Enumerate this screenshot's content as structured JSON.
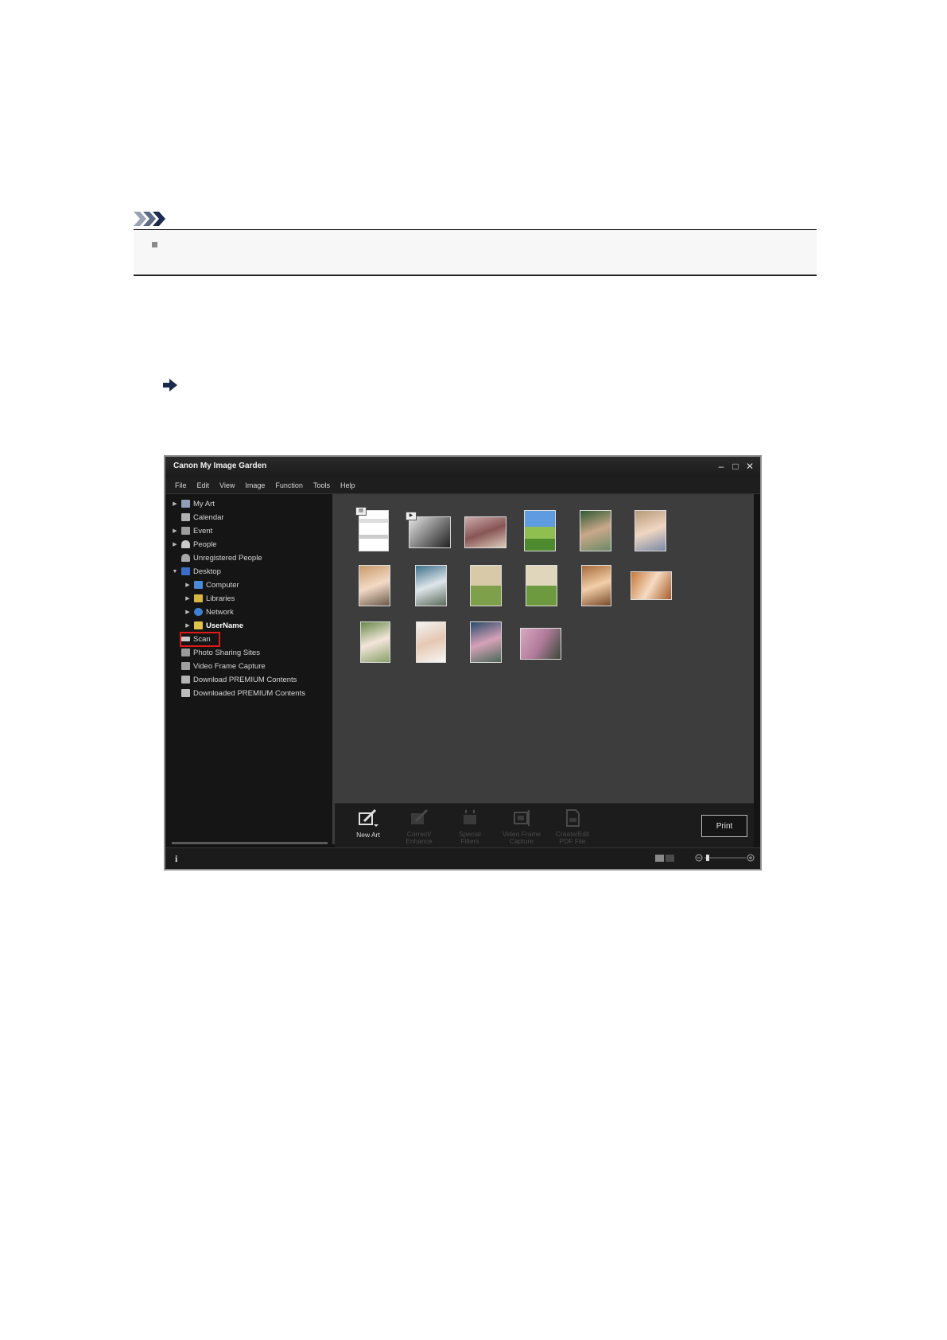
{
  "app": {
    "title": "Canon My Image Garden",
    "menu": [
      "File",
      "Edit",
      "View",
      "Image",
      "Function",
      "Tools",
      "Help"
    ],
    "tree": [
      {
        "label": "My Art",
        "level": 0,
        "arrow": true,
        "icon": "my-art-icon"
      },
      {
        "label": "Calendar",
        "level": 0,
        "arrow": false,
        "icon": "calendar-icon"
      },
      {
        "label": "Event",
        "level": 0,
        "arrow": true,
        "icon": "event-icon"
      },
      {
        "label": "People",
        "level": 0,
        "arrow": true,
        "icon": "people-icon"
      },
      {
        "label": "Unregistered People",
        "level": 0,
        "arrow": false,
        "icon": "unregistered-people-icon"
      },
      {
        "label": "Desktop",
        "level": 0,
        "arrow": true,
        "expanded": true,
        "icon": "desktop-icon"
      },
      {
        "label": "Computer",
        "level": 1,
        "arrow": true,
        "icon": "computer-icon"
      },
      {
        "label": "Libraries",
        "level": 1,
        "arrow": true,
        "icon": "libraries-icon"
      },
      {
        "label": "Network",
        "level": 1,
        "arrow": true,
        "icon": "network-icon"
      },
      {
        "label": "UserName",
        "level": 1,
        "arrow": true,
        "bold": true,
        "icon": "user-folder-icon"
      },
      {
        "label": "Scan",
        "level": 0,
        "arrow": false,
        "highlighted": true,
        "icon": "scan-icon"
      },
      {
        "label": "Photo Sharing Sites",
        "level": 0,
        "arrow": false,
        "icon": "photo-sharing-icon"
      },
      {
        "label": "Video Frame Capture",
        "level": 0,
        "arrow": false,
        "icon": "video-frame-icon"
      },
      {
        "label": "Download PREMIUM Contents",
        "level": 0,
        "arrow": false,
        "icon": "download-premium-icon"
      },
      {
        "label": "Downloaded PREMIUM Contents",
        "level": 0,
        "arrow": false,
        "icon": "downloaded-premium-icon"
      }
    ],
    "toolbar": {
      "tools": [
        {
          "label": "New Art",
          "disabled": false
        },
        {
          "label": "Correct/\nEnhance",
          "disabled": true
        },
        {
          "label": "Special\nFilters",
          "disabled": true
        },
        {
          "label": "Video Frame\nCapture",
          "disabled": true
        },
        {
          "label": "Create/Edit\nPDF File",
          "disabled": true
        }
      ],
      "print_label": "Print"
    },
    "colors": {
      "highlight": "#e01818",
      "panel": "#151515",
      "content": "#3d3d3d"
    }
  }
}
